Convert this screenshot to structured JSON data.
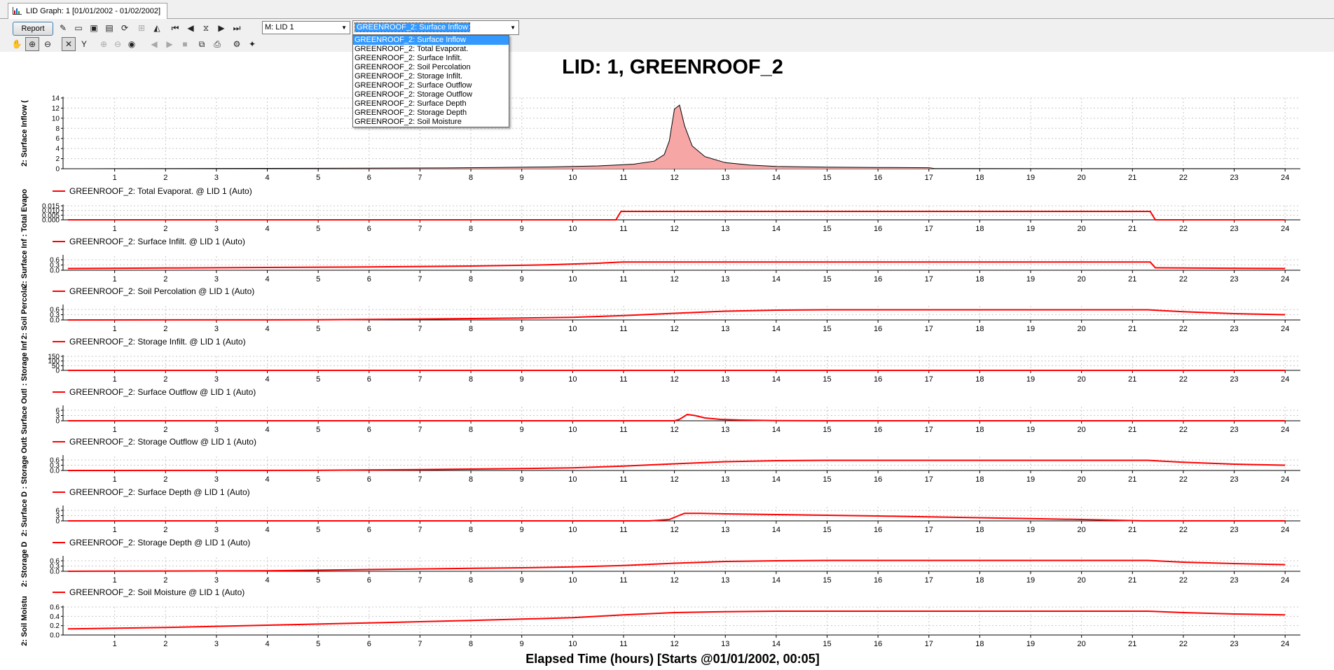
{
  "window": {
    "tab_title": "LID Graph: 1 [01/01/2002 - 01/02/2002]"
  },
  "toolbar": {
    "report_label": "Report",
    "location_value": "M: LID 1",
    "series_value": "GREENROOF_2: Surface Inflow"
  },
  "dropdown": {
    "options": [
      "GREENROOF_2: Surface Inflow",
      "GREENROOF_2: Total Evaporat.",
      "GREENROOF_2: Surface Infilt.",
      "GREENROOF_2: Soil Percolation",
      "GREENROOF_2: Storage Infilt.",
      "GREENROOF_2: Surface Outflow",
      "GREENROOF_2: Storage Outflow",
      "GREENROOF_2: Surface Depth",
      "GREENROOF_2: Storage Depth",
      "GREENROOF_2: Soil Moisture"
    ],
    "selected_index": 0
  },
  "colors": {
    "series": "#ff0000",
    "area_fill": "#f7a6a6",
    "grid": "#c8c8c8"
  },
  "chart_data": {
    "type": "line",
    "title": "LID: 1, GREENROOF_2",
    "xlabel": "Elapsed Time (hours) [Starts @01/01/2002, 00:05]",
    "xlim": [
      0,
      24.3
    ],
    "xticks": [
      1,
      2,
      3,
      4,
      5,
      6,
      7,
      8,
      9,
      10,
      11,
      12,
      13,
      14,
      15,
      16,
      17,
      18,
      19,
      20,
      21,
      22,
      23,
      24
    ],
    "grid": true,
    "legend_placement": "top-left",
    "panels": [
      {
        "ylabel": "2: Surface Inflow (",
        "style": "area",
        "ylim": [
          0,
          14
        ],
        "yticks": [
          0,
          2,
          4,
          6,
          8,
          10,
          12,
          14
        ],
        "points": [
          [
            0.08,
            0
          ],
          [
            1,
            0.02
          ],
          [
            3,
            0.05
          ],
          [
            5,
            0.08
          ],
          [
            7.5,
            0.15
          ],
          [
            8.5,
            0.25
          ],
          [
            9.5,
            0.35
          ],
          [
            10.5,
            0.55
          ],
          [
            11.2,
            0.9
          ],
          [
            11.6,
            1.5
          ],
          [
            11.8,
            2.8
          ],
          [
            11.9,
            5.5
          ],
          [
            12.0,
            11.8
          ],
          [
            12.1,
            12.6
          ],
          [
            12.2,
            8.5
          ],
          [
            12.35,
            4.5
          ],
          [
            12.6,
            2.4
          ],
          [
            13.0,
            1.2
          ],
          [
            13.5,
            0.7
          ],
          [
            14.0,
            0.45
          ],
          [
            15,
            0.3
          ],
          [
            16,
            0.25
          ],
          [
            17,
            0.2
          ],
          [
            17.1,
            0.05
          ],
          [
            18,
            0.03
          ],
          [
            24,
            0.02
          ]
        ]
      },
      {
        "legend": "GREENROOF_2: Total Evaporat. @ LID 1 (Auto)",
        "ylabel": ": Total Evapo",
        "ylim": [
          0,
          0.015
        ],
        "yticks": [
          0.0,
          0.005,
          0.01,
          0.015
        ],
        "ytick_labels": [
          "0.000",
          "0.005",
          "0.010",
          "0.015"
        ],
        "points": [
          [
            0.08,
            0
          ],
          [
            10.85,
            0
          ],
          [
            10.95,
            0.009
          ],
          [
            21.35,
            0.009
          ],
          [
            21.45,
            0
          ],
          [
            24,
            0
          ]
        ]
      },
      {
        "legend": "GREENROOF_2: Surface Infilt. @ LID 1 (Auto)",
        "ylabel": "2: Surface Inf",
        "ylim": [
          0,
          0.8
        ],
        "yticks": [
          0.0,
          0.3,
          0.6
        ],
        "ytick_labels": [
          "0.0",
          "0.3",
          "0.6"
        ],
        "points": [
          [
            0.08,
            0.1
          ],
          [
            2,
            0.13
          ],
          [
            4,
            0.16
          ],
          [
            6,
            0.19
          ],
          [
            8,
            0.24
          ],
          [
            9.5,
            0.31
          ],
          [
            10.5,
            0.4
          ],
          [
            10.9,
            0.46
          ],
          [
            11.0,
            0.47
          ],
          [
            21.35,
            0.47
          ],
          [
            21.45,
            0.14
          ],
          [
            22,
            0.13
          ],
          [
            24,
            0.1
          ]
        ]
      },
      {
        "legend": "GREENROOF_2: Soil Percolation @ LID 1 (Auto)",
        "ylabel": "2: Soil Percola",
        "ylim": [
          0,
          0.8
        ],
        "yticks": [
          0.0,
          0.3,
          0.6
        ],
        "ytick_labels": [
          "0.0",
          "0.3",
          "0.6"
        ],
        "points": [
          [
            0.08,
            0.0
          ],
          [
            5,
            0.01
          ],
          [
            6,
            0.03
          ],
          [
            7,
            0.05
          ],
          [
            8,
            0.08
          ],
          [
            9,
            0.11
          ],
          [
            10,
            0.15
          ],
          [
            11,
            0.25
          ],
          [
            12,
            0.38
          ],
          [
            13,
            0.5
          ],
          [
            14,
            0.56
          ],
          [
            15,
            0.58
          ],
          [
            21.3,
            0.58
          ],
          [
            22,
            0.47
          ],
          [
            23,
            0.36
          ],
          [
            24,
            0.3
          ]
        ]
      },
      {
        "legend": "GREENROOF_2: Storage Infilt. @ LID 1 (Auto)",
        "ylabel": ": Storage Inf",
        "ylim": [
          0,
          150
        ],
        "yticks": [
          0,
          50,
          100,
          150
        ],
        "ytick_labels": [
          "0",
          "50",
          "100",
          "150"
        ],
        "points": [
          [
            0.08,
            0
          ],
          [
            24,
            0
          ]
        ]
      },
      {
        "legend": "GREENROOF_2: Surface Outflow @ LID 1 (Auto)",
        "ylabel": ": Surface Outl",
        "ylim": [
          0,
          8
        ],
        "yticks": [
          0,
          3,
          6
        ],
        "ytick_labels": [
          "0",
          "3",
          "6"
        ],
        "points": [
          [
            0.08,
            0
          ],
          [
            12.0,
            0
          ],
          [
            12.1,
            0.8
          ],
          [
            12.25,
            3.6
          ],
          [
            12.4,
            3.0
          ],
          [
            12.6,
            1.6
          ],
          [
            12.9,
            0.8
          ],
          [
            13.3,
            0.4
          ],
          [
            14,
            0.1
          ],
          [
            15,
            0
          ],
          [
            24,
            0
          ]
        ]
      },
      {
        "legend": "GREENROOF_2: Storage Outflow @ LID 1 (Auto)",
        "ylabel": ": Storage Outl",
        "ylim": [
          0,
          0.8
        ],
        "yticks": [
          0.0,
          0.3,
          0.6
        ],
        "ytick_labels": [
          "0.0",
          "0.3",
          "0.6"
        ],
        "points": [
          [
            0.08,
            0.0
          ],
          [
            5,
            0.01
          ],
          [
            6,
            0.03
          ],
          [
            7,
            0.05
          ],
          [
            8,
            0.08
          ],
          [
            9,
            0.11
          ],
          [
            10,
            0.15
          ],
          [
            11,
            0.25
          ],
          [
            12,
            0.38
          ],
          [
            13,
            0.5
          ],
          [
            14,
            0.56
          ],
          [
            15,
            0.58
          ],
          [
            21.3,
            0.58
          ],
          [
            22,
            0.47
          ],
          [
            23,
            0.36
          ],
          [
            24,
            0.3
          ]
        ]
      },
      {
        "legend": "GREENROOF_2: Surface Depth @ LID 1 (Auto)",
        "ylabel": "2: Surface D",
        "ylim": [
          0,
          8
        ],
        "yticks": [
          0,
          3,
          6
        ],
        "ytick_labels": [
          "0",
          "3",
          "6"
        ],
        "points": [
          [
            0.08,
            0
          ],
          [
            11.5,
            0
          ],
          [
            11.9,
            0.8
          ],
          [
            12.1,
            3.2
          ],
          [
            12.2,
            4.3
          ],
          [
            12.5,
            4.3
          ],
          [
            13,
            4.0
          ],
          [
            14,
            3.6
          ],
          [
            15,
            3.2
          ],
          [
            16,
            2.8
          ],
          [
            17,
            2.3
          ],
          [
            18,
            1.8
          ],
          [
            19,
            1.3
          ],
          [
            20,
            0.8
          ],
          [
            20.8,
            0.3
          ],
          [
            21.2,
            0.05
          ],
          [
            24,
            0
          ]
        ]
      },
      {
        "legend": "GREENROOF_2: Storage Depth @ LID 1 (Auto)",
        "ylabel": "2: Storage D",
        "ylim": [
          0,
          0.8
        ],
        "yticks": [
          0.0,
          0.3,
          0.6
        ],
        "ytick_labels": [
          "0.0",
          "0.3",
          "0.6"
        ],
        "points": [
          [
            0.08,
            0.0
          ],
          [
            4,
            0.03
          ],
          [
            6,
            0.1
          ],
          [
            8,
            0.17
          ],
          [
            9,
            0.2
          ],
          [
            10,
            0.25
          ],
          [
            11,
            0.33
          ],
          [
            12,
            0.46
          ],
          [
            13,
            0.56
          ],
          [
            14,
            0.6
          ],
          [
            15,
            0.62
          ],
          [
            21.3,
            0.62
          ],
          [
            22,
            0.52
          ],
          [
            23,
            0.44
          ],
          [
            24,
            0.38
          ]
        ]
      },
      {
        "legend": "GREENROOF_2: Soil Moisture @ LID 1 (Auto)",
        "ylabel": "2: Soil Moistu",
        "ylim": [
          0,
          0.6
        ],
        "yticks": [
          0.0,
          0.2,
          0.4,
          0.6
        ],
        "ytick_labels": [
          "0.0",
          "0.2",
          "0.4",
          "0.6"
        ],
        "points": [
          [
            0.08,
            0.13
          ],
          [
            2,
            0.16
          ],
          [
            4,
            0.21
          ],
          [
            6,
            0.26
          ],
          [
            8,
            0.31
          ],
          [
            9,
            0.34
          ],
          [
            10,
            0.37
          ],
          [
            11,
            0.43
          ],
          [
            12,
            0.48
          ],
          [
            13,
            0.5
          ],
          [
            14,
            0.51
          ],
          [
            21.3,
            0.51
          ],
          [
            22,
            0.48
          ],
          [
            23,
            0.45
          ],
          [
            24,
            0.43
          ]
        ]
      }
    ]
  }
}
